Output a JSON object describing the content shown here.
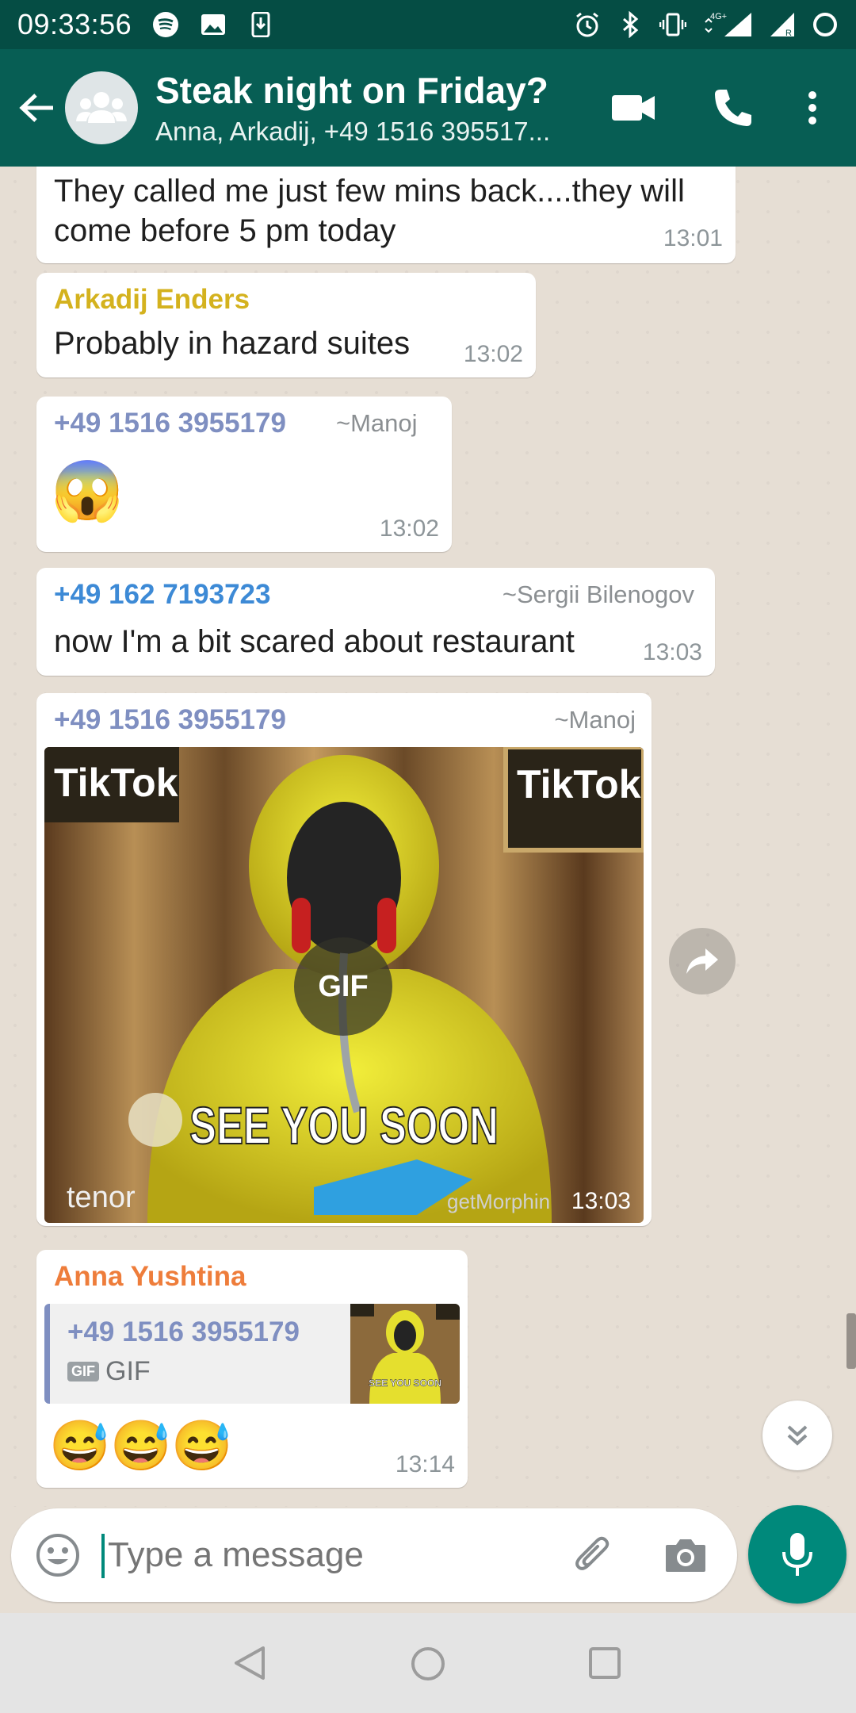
{
  "status_bar": {
    "time": "09:33:56",
    "network": "4G+"
  },
  "header": {
    "title": "Steak night on Friday?",
    "subtitle": "Anna, Arkadij, +49 1516 395517..."
  },
  "messages": [
    {
      "text": "They called me just few mins back....they will come before 5 pm today",
      "time": "13:01"
    },
    {
      "sender": "Arkadij Enders",
      "sender_color": "#d4b21e",
      "text": "Probably in hazard suites",
      "time": "13:02"
    },
    {
      "sender": "+49 1516 3955179",
      "sender_color": "#7f8fc1",
      "alias": "~Manoj",
      "emoji": "😱",
      "time": "13:02"
    },
    {
      "sender": "+49 162 7193723",
      "sender_color": "#3d8ad6",
      "alias": "~Sergii Bilenogov",
      "text": "now I'm a bit scared about restaurant",
      "time": "13:03"
    },
    {
      "sender": "+49 1516 3955179",
      "sender_color": "#7f8fc1",
      "alias": "~Manoj",
      "gif": {
        "badge": "GIF",
        "caption": "SEE YOU SOON",
        "watermark_left": "TikTok",
        "watermark_right": "TikTok",
        "tenor": "tenor",
        "credit": "getMorphin"
      },
      "time": "13:03"
    },
    {
      "sender": "Anna Yushtina",
      "sender_color": "#ee7d3b",
      "quote": {
        "sender": "+49 1516 3955179",
        "badge": "GIF",
        "label": "GIF",
        "thumb_caption": "SEE YOU SOON"
      },
      "emoji": "😅😅😅",
      "time": "13:14"
    }
  ],
  "composer": {
    "placeholder": "Type a message"
  },
  "colors": {
    "header": "#075e54",
    "status_bar": "#054d44",
    "accent": "#00897b"
  }
}
